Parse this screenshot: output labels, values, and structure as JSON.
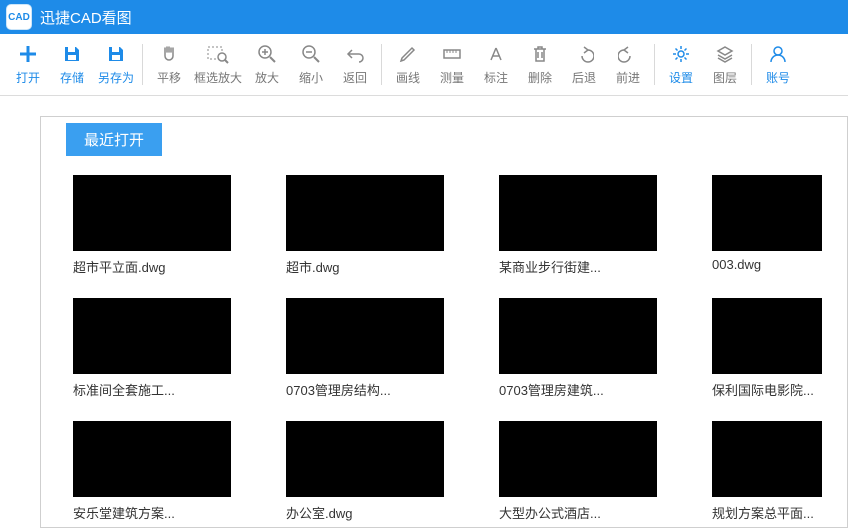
{
  "app": {
    "title": "迅捷CAD看图",
    "logo_text": "CAD"
  },
  "toolbar": {
    "open": "打开",
    "save": "存储",
    "saveas": "另存为",
    "pan": "平移",
    "boxzoom": "框选放大",
    "zoomin": "放大",
    "zoomout": "缩小",
    "back": "返回",
    "drawline": "画线",
    "measure": "测量",
    "annotate": "标注",
    "delete": "删除",
    "undo": "后退",
    "redo": "前进",
    "settings": "设置",
    "layers": "图层",
    "account": "账号"
  },
  "recent": {
    "tab": "最近打开",
    "files": [
      "超市平立面.dwg",
      "超市.dwg",
      "某商业步行街建...",
      "003.dwg",
      "标准间全套施工...",
      "0703管理房结构...",
      "0703管理房建筑...",
      "保利国际电影院...",
      "安乐堂建筑方案...",
      "办公室.dwg",
      "大型办公式酒店...",
      "规划方案总平面..."
    ]
  }
}
